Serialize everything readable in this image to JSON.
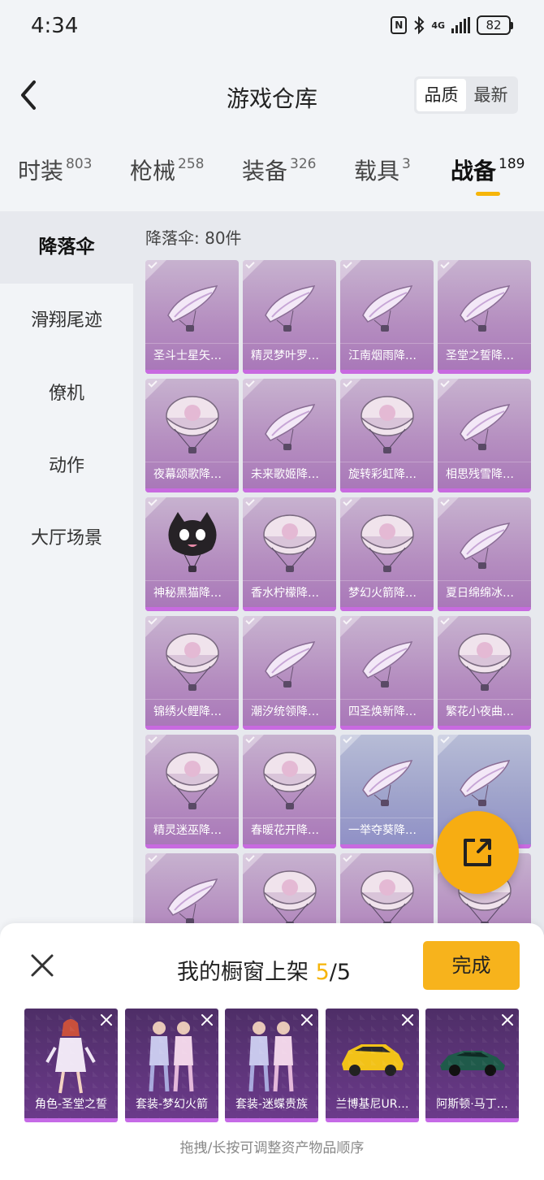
{
  "status_bar": {
    "time": "4:34",
    "network": "4G",
    "battery": "82"
  },
  "header": {
    "title": "游戏仓库",
    "sort_options": [
      "品质",
      "最新"
    ],
    "sort_active": "品质"
  },
  "category_tabs": [
    {
      "label": "时装",
      "count": "803"
    },
    {
      "label": "枪械",
      "count": "258"
    },
    {
      "label": "装备",
      "count": "326"
    },
    {
      "label": "载具",
      "count": "3"
    },
    {
      "label": "战备",
      "count": "189",
      "active": true
    }
  ],
  "sidebar": {
    "items": [
      {
        "label": "降落伞",
        "active": true
      },
      {
        "label": "滑翔尾迹"
      },
      {
        "label": "僚机"
      },
      {
        "label": "动作"
      },
      {
        "label": "大厅场景"
      }
    ]
  },
  "main": {
    "count_label": "降落伞: 80件",
    "items": [
      {
        "name": "圣斗士星矢…",
        "kind": "glider"
      },
      {
        "name": "精灵梦叶罗…",
        "kind": "glider"
      },
      {
        "name": "江南烟雨降…",
        "kind": "glider"
      },
      {
        "name": "圣堂之誓降…",
        "kind": "glider"
      },
      {
        "name": "夜幕颂歌降…",
        "kind": "dome"
      },
      {
        "name": "未来歌姬降…",
        "kind": "glider"
      },
      {
        "name": "旋转彩虹降…",
        "kind": "dome"
      },
      {
        "name": "相思残雪降…",
        "kind": "glider"
      },
      {
        "name": "神秘黑猫降…",
        "kind": "cat"
      },
      {
        "name": "香水柠檬降…",
        "kind": "dome"
      },
      {
        "name": "梦幻火箭降…",
        "kind": "dome"
      },
      {
        "name": "夏日绵绵冰…",
        "kind": "glider"
      },
      {
        "name": "锦绣火鲤降…",
        "kind": "dome"
      },
      {
        "name": "潮汐统领降…",
        "kind": "glider"
      },
      {
        "name": "四圣焕新降…",
        "kind": "glider"
      },
      {
        "name": "繁花小夜曲…",
        "kind": "dome"
      },
      {
        "name": "精灵迷巫降…",
        "kind": "dome"
      },
      {
        "name": "春暖花开降…",
        "kind": "dome"
      },
      {
        "name": "一举夺葵降…",
        "kind": "glider"
      },
      {
        "name": "",
        "kind": "glider"
      },
      {
        "name": "",
        "kind": "glider"
      },
      {
        "name": "",
        "kind": "dome"
      },
      {
        "name": "",
        "kind": "dome"
      },
      {
        "name": "",
        "kind": "dome"
      }
    ]
  },
  "showcase": {
    "title": "我的橱窗上架",
    "current": "5",
    "total": "/5",
    "done_label": "完成",
    "items": [
      {
        "label": "角色-圣堂之誓",
        "kind": "figure"
      },
      {
        "label": "套装-梦幻火箭",
        "kind": "pair"
      },
      {
        "label": "套装-迷蝶贵族",
        "kind": "pair"
      },
      {
        "label": "兰博基尼UR…",
        "kind": "car-yellow"
      },
      {
        "label": "阿斯顿·马丁…",
        "kind": "car-green"
      }
    ],
    "hint": "拖拽/长按可调整资产物品顺序"
  },
  "colors": {
    "accent": "#f6b50a",
    "card_purple": "#b58ec0",
    "card_blue": "#9fa3cb"
  }
}
